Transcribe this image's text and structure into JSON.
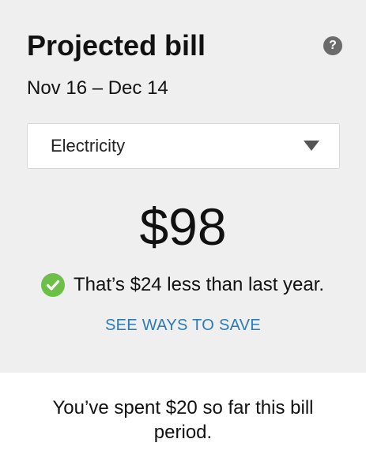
{
  "card": {
    "title": "Projected bill",
    "help_icon": "question-mark-icon",
    "help_glyph": "?",
    "date_range": "Nov 16 – Dec 14",
    "fuel_select": {
      "value": "Electricity",
      "icon": "chevron-down-icon"
    },
    "projected_amount": "$98",
    "comparison": {
      "icon": "check-circle-icon",
      "text": "That’s $24 less than last year."
    },
    "save_link_label": "SEE WAYS TO SAVE"
  },
  "footer": {
    "spent_text": "You’ve spent $20 so far this bill period."
  },
  "colors": {
    "card_background": "#efefef",
    "link": "#2b7bb4",
    "success": "#6cbf47",
    "help_icon": "#6b6b6b"
  }
}
